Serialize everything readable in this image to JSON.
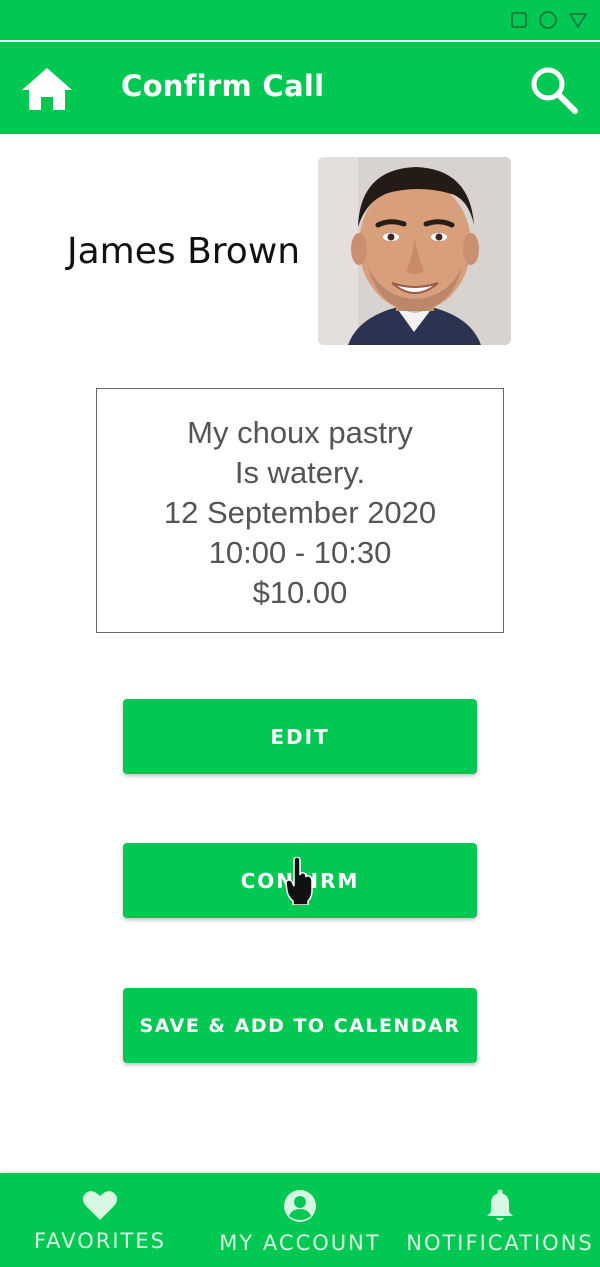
{
  "app_bar": {
    "title": "Confirm Call"
  },
  "contact": {
    "name": "James Brown"
  },
  "details": {
    "lines": [
      "My choux pastry",
      "Is watery.",
      "12 September 2020",
      "10:00 - 10:30",
      "$10.00"
    ]
  },
  "actions": {
    "edit_label": "EDIT",
    "confirm_label": "CONFIRM",
    "save_label": "SAVE & ADD TO CALENDAR"
  },
  "bottom_nav": {
    "items": [
      {
        "label": "FAVORITES",
        "icon": "heart-icon"
      },
      {
        "label": "MY ACCOUNT",
        "icon": "account-circle-icon"
      },
      {
        "label": "NOTIFICATIONS",
        "icon": "bell-icon"
      }
    ]
  },
  "colors": {
    "primary": "#00c853",
    "nav_label": "#d7f7e2",
    "text_muted": "#555555"
  }
}
